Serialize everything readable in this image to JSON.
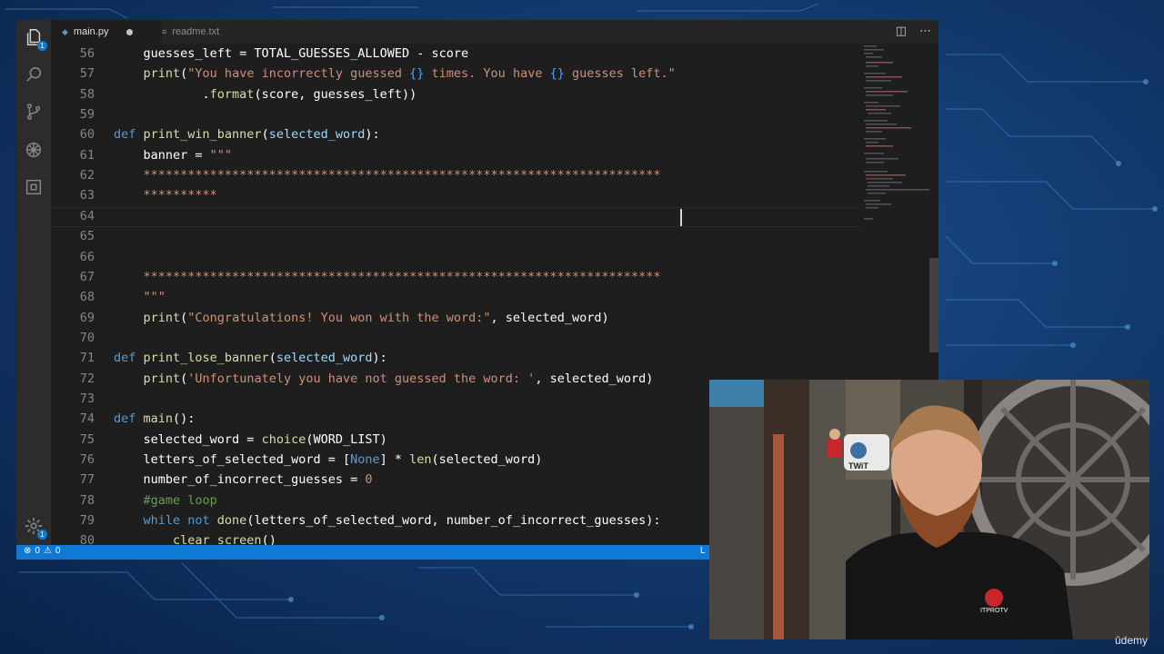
{
  "tabs": [
    {
      "label": "main.py",
      "active": true,
      "dirty": true
    },
    {
      "label": "readme.txt",
      "active": false,
      "dirty": false
    }
  ],
  "activity_bar": [
    {
      "icon": "files-icon",
      "badge": "1"
    },
    {
      "icon": "search-icon"
    },
    {
      "icon": "source-control-icon"
    },
    {
      "icon": "debug-icon"
    },
    {
      "icon": "extensions-icon"
    },
    {
      "icon": "gear-icon",
      "badge": "1"
    }
  ],
  "editor": {
    "lines": [
      {
        "n": "56",
        "tokens": [
          [
            "id",
            "    guesses_left = TOTAL_GUESSES_ALLOWED - score"
          ]
        ]
      },
      {
        "n": "57",
        "tokens": [
          [
            "id",
            "    "
          ],
          [
            "fn",
            "print"
          ],
          [
            "id",
            "("
          ],
          [
            "str",
            "\"You have incorrectly guessed "
          ],
          [
            "brace",
            "{}"
          ],
          [
            "str",
            " times. You have "
          ],
          [
            "brace",
            "{}"
          ],
          [
            "str",
            " guesses left.\""
          ]
        ]
      },
      {
        "n": "58",
        "tokens": [
          [
            "id",
            "            ."
          ],
          [
            "fn",
            "format"
          ],
          [
            "id",
            "(score, guesses_left))"
          ]
        ]
      },
      {
        "n": "59",
        "tokens": []
      },
      {
        "n": "60",
        "tokens": [
          [
            "kw",
            "def "
          ],
          [
            "fn",
            "print_win_banner"
          ],
          [
            "id",
            "("
          ],
          [
            "param",
            "selected_word"
          ],
          [
            "id",
            "):"
          ]
        ]
      },
      {
        "n": "61",
        "tokens": [
          [
            "id",
            "    banner = "
          ],
          [
            "str",
            "\"\"\""
          ]
        ]
      },
      {
        "n": "62",
        "tokens": [
          [
            "str",
            "    **********************************************************************"
          ]
        ]
      },
      {
        "n": "63",
        "tokens": [
          [
            "str",
            "    **********"
          ]
        ]
      },
      {
        "n": "64",
        "tokens": []
      },
      {
        "n": "65",
        "tokens": []
      },
      {
        "n": "66",
        "tokens": []
      },
      {
        "n": "67",
        "tokens": [
          [
            "str",
            "    **********************************************************************"
          ]
        ]
      },
      {
        "n": "68",
        "tokens": [
          [
            "str",
            "    \"\"\""
          ]
        ]
      },
      {
        "n": "69",
        "tokens": [
          [
            "id",
            "    "
          ],
          [
            "fn",
            "print"
          ],
          [
            "id",
            "("
          ],
          [
            "str",
            "\"Congratulations! You won with the word:\""
          ],
          [
            "id",
            ", selected_word)"
          ]
        ]
      },
      {
        "n": "70",
        "tokens": []
      },
      {
        "n": "71",
        "tokens": [
          [
            "kw",
            "def "
          ],
          [
            "fn",
            "print_lose_banner"
          ],
          [
            "id",
            "("
          ],
          [
            "param",
            "selected_word"
          ],
          [
            "id",
            "):"
          ]
        ]
      },
      {
        "n": "72",
        "tokens": [
          [
            "id",
            "    "
          ],
          [
            "fn",
            "print"
          ],
          [
            "id",
            "("
          ],
          [
            "str",
            "'Unfortunately you have not guessed the word: '"
          ],
          [
            "id",
            ", selected_word)"
          ]
        ]
      },
      {
        "n": "73",
        "tokens": []
      },
      {
        "n": "74",
        "tokens": [
          [
            "kw",
            "def "
          ],
          [
            "fn",
            "main"
          ],
          [
            "id",
            "():"
          ]
        ]
      },
      {
        "n": "75",
        "tokens": [
          [
            "id",
            "    selected_word = "
          ],
          [
            "fn",
            "choice"
          ],
          [
            "id",
            "(WORD_LIST)"
          ]
        ]
      },
      {
        "n": "76",
        "tokens": [
          [
            "id",
            "    letters_of_selected_word = ["
          ],
          [
            "kw",
            "None"
          ],
          [
            "id",
            "] * "
          ],
          [
            "fn",
            "len"
          ],
          [
            "id",
            "(selected_word)"
          ]
        ]
      },
      {
        "n": "77",
        "tokens": [
          [
            "id",
            "    number_of_incorrect_guesses = "
          ],
          [
            "str",
            "0"
          ]
        ]
      },
      {
        "n": "78",
        "tokens": [
          [
            "cm",
            "    #game loop"
          ]
        ]
      },
      {
        "n": "79",
        "tokens": [
          [
            "id",
            "    "
          ],
          [
            "kw",
            "while not "
          ],
          [
            "fn",
            "done"
          ],
          [
            "id",
            "(letters_of_selected_word, number_of_incorrect_guesses):"
          ]
        ]
      },
      {
        "n": "80",
        "tokens": [
          [
            "id",
            "        "
          ],
          [
            "fn",
            "clear_screen"
          ],
          [
            "id",
            "()"
          ]
        ]
      }
    ]
  },
  "status_bar": {
    "errors": "0",
    "warnings": "0",
    "right_text": "L"
  },
  "webcam": {
    "shirt_logo": "ITPROTV",
    "mug_text": "TWiT"
  },
  "watermark": "ûdemy",
  "colors": {
    "accent": "#0e7ad6",
    "editor_bg": "#1e1e1e",
    "keyword": "#569cd6",
    "function": "#dcdcaa",
    "string": "#ce9178"
  }
}
